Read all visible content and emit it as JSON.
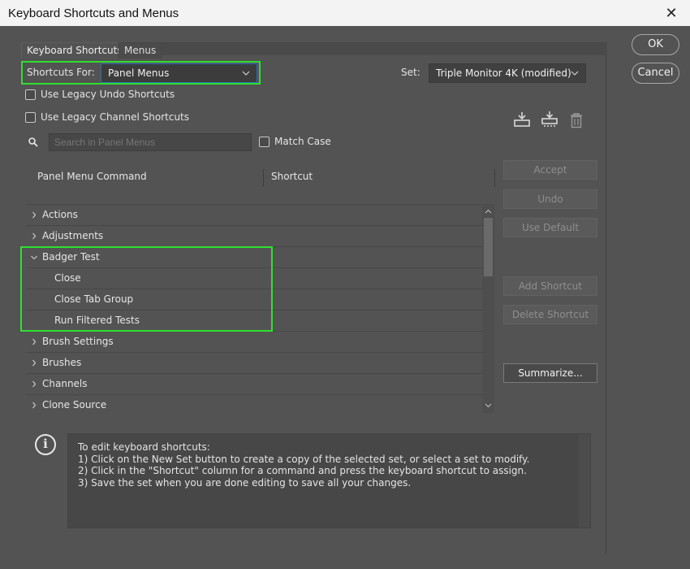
{
  "window": {
    "title": "Keyboard Shortcuts and Menus",
    "close_glyph": "✕"
  },
  "tabs": [
    {
      "label": "Keyboard Shortcuts",
      "active": true
    },
    {
      "label": "Menus",
      "active": false
    }
  ],
  "shortcuts_for": {
    "label": "Shortcuts For:",
    "value": "Panel Menus"
  },
  "set": {
    "label": "Set:",
    "value": "Triple Monitor 4K (modified)"
  },
  "options": {
    "legacy_undo": {
      "label": "Use Legacy Undo Shortcuts",
      "checked": false
    },
    "legacy_channel": {
      "label": "Use Legacy Channel Shortcuts",
      "checked": false
    },
    "match_case": {
      "label": "Match Case",
      "checked": false
    }
  },
  "search": {
    "placeholder": "Search in Panel Menus",
    "icon": "search-icon"
  },
  "table": {
    "columns": [
      "Panel Menu Command",
      "Shortcut"
    ],
    "rows": [
      {
        "label": "Actions",
        "type": "group",
        "expanded": false
      },
      {
        "label": "Adjustments",
        "type": "group",
        "expanded": false
      },
      {
        "label": "Badger Test",
        "type": "group",
        "expanded": true
      },
      {
        "label": "Close",
        "type": "item",
        "shortcut": ""
      },
      {
        "label": "Close Tab Group",
        "type": "item",
        "shortcut": ""
      },
      {
        "label": "Run Filtered Tests",
        "type": "item",
        "shortcut": ""
      },
      {
        "label": "Brush Settings",
        "type": "group",
        "expanded": false
      },
      {
        "label": "Brushes",
        "type": "group",
        "expanded": false
      },
      {
        "label": "Channels",
        "type": "group",
        "expanded": false
      },
      {
        "label": "Clone Source",
        "type": "group",
        "expanded": false
      }
    ]
  },
  "buttons": {
    "ok": "OK",
    "cancel": "Cancel",
    "accept": "Accept",
    "undo": "Undo",
    "use_default": "Use Default",
    "add_shortcut": "Add Shortcut",
    "delete_shortcut": "Delete Shortcut",
    "summarize": "Summarize..."
  },
  "set_icons": [
    "save-set-icon",
    "save-set-as-icon",
    "delete-set-icon"
  ],
  "info": {
    "lines": [
      "To edit keyboard shortcuts:",
      "1) Click on the New Set button to create a copy of the selected set, or select a set to modify.",
      "2) Click in the \"Shortcut\" column for a command and press the keyboard shortcut to assign.",
      "3) Save the set when you are done editing to save all your changes."
    ]
  },
  "colors": {
    "background": "#535353",
    "highlight": "#2ee02e",
    "titlebar": "#f3f3f3"
  }
}
